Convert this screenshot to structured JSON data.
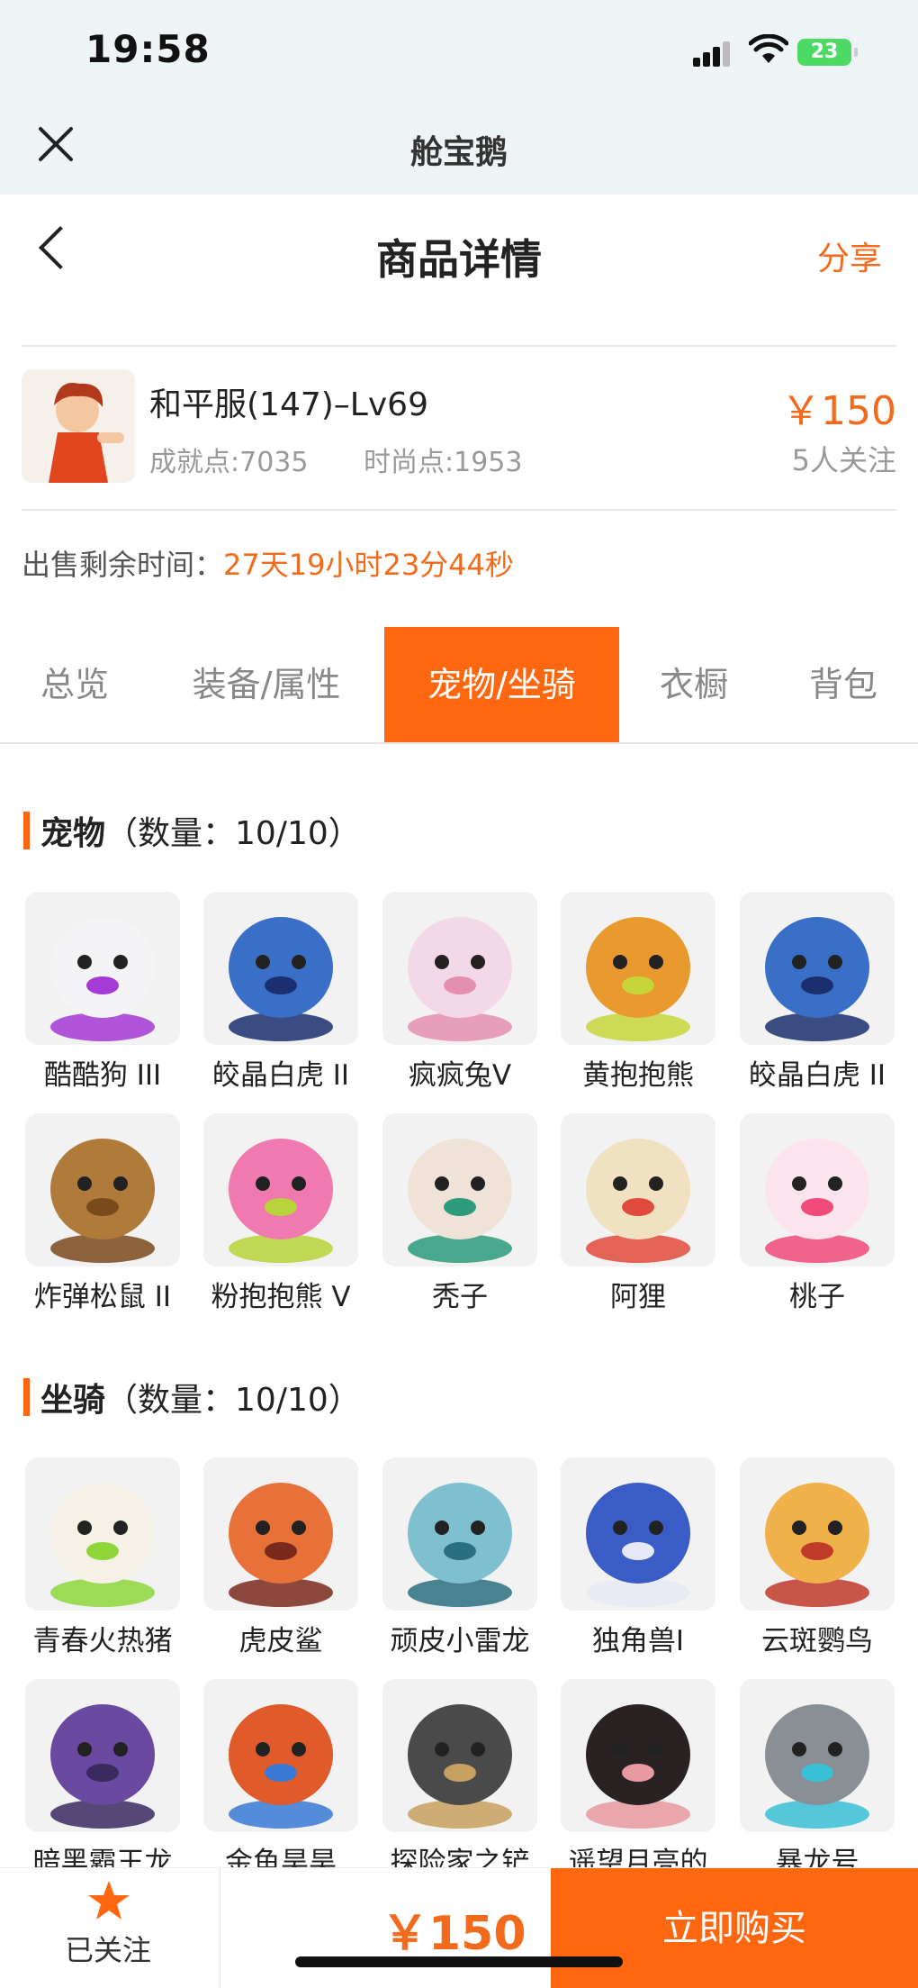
{
  "status": {
    "time": "19:58",
    "battery": "23"
  },
  "mini_header": {
    "title": "舱宝鹅"
  },
  "nav": {
    "title": "商品详情",
    "share": "分享"
  },
  "product": {
    "name": "和平服(147)–Lv69",
    "achievement": "成就点:7035",
    "fashion": "时尚点:1953",
    "price": "￥150",
    "watchers": "5人关注"
  },
  "remaining": {
    "label": "出售剩余时间：",
    "value": "27天19小时23分44秒"
  },
  "tabs": [
    {
      "label": "总览"
    },
    {
      "label": "装备/属性"
    },
    {
      "label": "宠物/坐骑"
    },
    {
      "label": "衣橱"
    },
    {
      "label": "背包"
    }
  ],
  "pets": {
    "title": "宠物",
    "count": "（数量：10/10）",
    "items": [
      {
        "name": "酷酷狗 III",
        "color": "#f4f4f6",
        "accent": "#a53ad6"
      },
      {
        "name": "皎晶白虎 II",
        "color": "#3a6fc7",
        "accent": "#1b2f6e"
      },
      {
        "name": "疯疯兔V",
        "color": "#f3d8e8",
        "accent": "#e58fb0"
      },
      {
        "name": "黄抱抱熊",
        "color": "#e89a2f",
        "accent": "#c6d63a"
      },
      {
        "name": "皎晶白虎 II",
        "color": "#3a6fc7",
        "accent": "#1b2f6e"
      },
      {
        "name": "炸弹松鼠 II",
        "color": "#b07a3a",
        "accent": "#7a4a1c"
      },
      {
        "name": "粉抱抱熊 V",
        "color": "#f07ab0",
        "accent": "#b8d43a"
      },
      {
        "name": "秃子",
        "color": "#efe3d7",
        "accent": "#2c9a7c"
      },
      {
        "name": "阿狸",
        "color": "#f0e2c0",
        "accent": "#e04a3c"
      },
      {
        "name": "桃子",
        "color": "#fbe4ee",
        "accent": "#f04a7a"
      }
    ]
  },
  "mounts": {
    "title": "坐骑",
    "count": "（数量：10/10）",
    "items": [
      {
        "name": "青春火热猪",
        "color": "#f6f1e6",
        "accent": "#8ed63a"
      },
      {
        "name": "虎皮鲨",
        "color": "#e8713a",
        "accent": "#7a2a1c"
      },
      {
        "name": "顽皮小雷龙",
        "color": "#7ec0d0",
        "accent": "#2b6e80"
      },
      {
        "name": "独角兽I",
        "color": "#3a5cc7",
        "accent": "#e6e9f5"
      },
      {
        "name": "云斑鹦鸟",
        "color": "#f0b04a",
        "accent": "#c03a2a"
      },
      {
        "name": "暗黑霸王龙",
        "color": "#6a4aa0",
        "accent": "#3a2a60"
      },
      {
        "name": "金鱼昊昊",
        "color": "#e05a2a",
        "accent": "#3a7ad6"
      },
      {
        "name": "探险家之铲",
        "color": "#4a4a4a",
        "accent": "#c8a060"
      },
      {
        "name": "遥望月亮的",
        "color": "#2a2222",
        "accent": "#e89aa0"
      },
      {
        "name": "暴龙号",
        "color": "#8a8f96",
        "accent": "#3ac0d6"
      }
    ]
  },
  "footer": {
    "favorite": "已关注",
    "price": "￥150",
    "buy": "立即购买"
  }
}
